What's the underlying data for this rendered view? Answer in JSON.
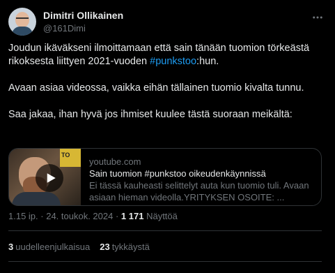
{
  "author": {
    "name": "Dimitri Ollikainen",
    "handle": "@161Dimi",
    "avatar_icon": "profile-photo"
  },
  "tweet": {
    "line1_part1": "Joudun ikäväkseni ilmoittamaan että sain tänään tuomion törkeästä rikoksesta liittyen 2021-vuoden ",
    "hashtag": "#punkstoo",
    "line1_part2": ":hun.",
    "paragraph2": "Avaan asiaa videossa, vaikka eihän tällainen tuomio kivalta tunnu.",
    "paragraph3": "Saa jakaa, ihan hyvä jos ihmiset kuulee tästä suoraan meikältä:"
  },
  "card": {
    "domain": "youtube.com",
    "title": "Sain tuomion #punkstoo oikeudenkäynnissä",
    "description": "Ei tässä kauheasti selittelyt auta kun tuomio tuli. Avaan asiaan hieman videolla.YRITYKSEN OSOITE: ...",
    "thumbnail_sign": "TO"
  },
  "meta": {
    "time": "1.15 ip.",
    "separator": " · ",
    "date": "24. toukok. 2024",
    "separator2": " · ",
    "views_count": "1 171",
    "views_label": " Näyttöä"
  },
  "stats": {
    "retweets_count": "3",
    "retweets_label": "uudelleenjulkaisua",
    "likes_count": "23",
    "likes_label": "tykkäystä"
  },
  "colors": {
    "background": "#000000",
    "text": "#e7e9ea",
    "muted": "#71767b",
    "accent": "#1d9bf0",
    "border": "#2f3336"
  }
}
